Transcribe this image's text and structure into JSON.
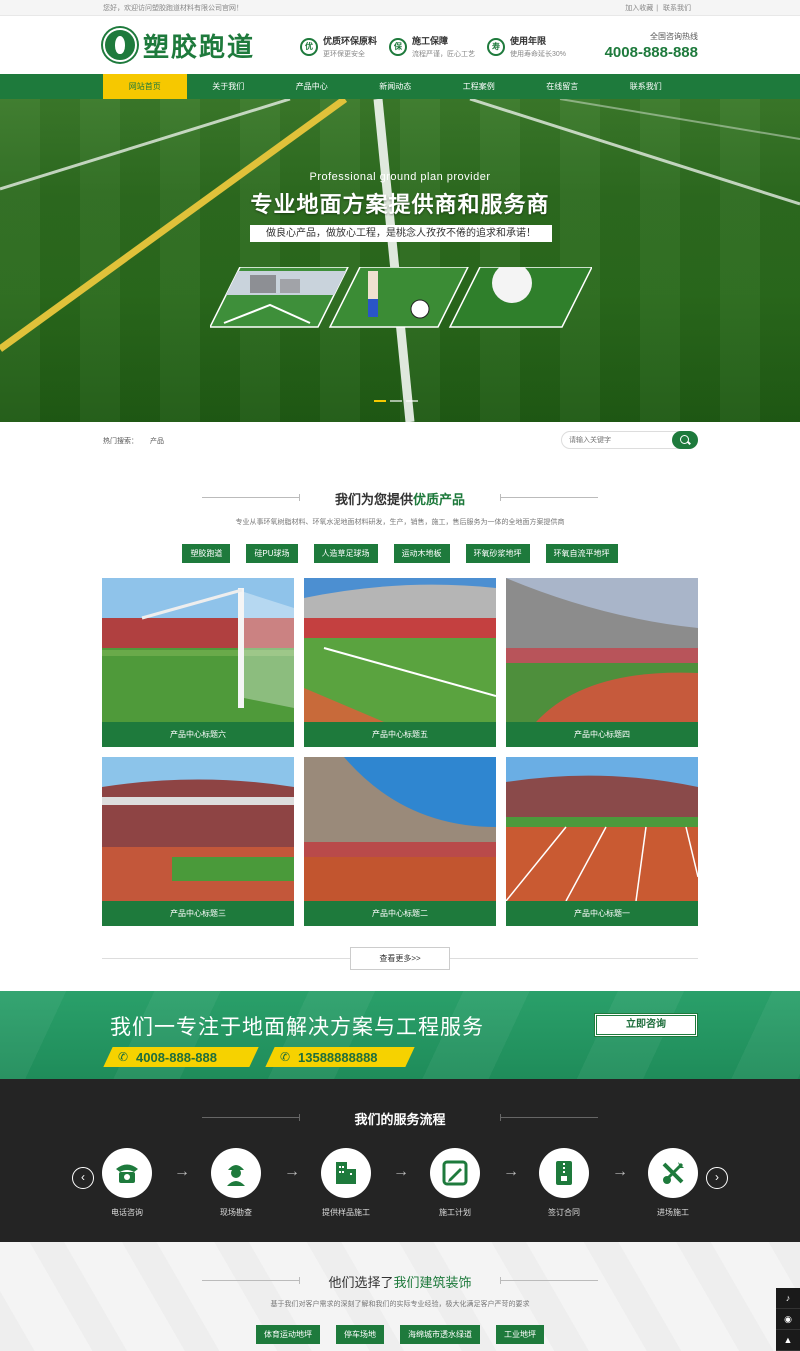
{
  "topbar": {
    "welcome": "您好，欢迎访问塑胶跑道材料有限公司官网！",
    "links": [
      "加入收藏",
      "联系我们"
    ]
  },
  "header": {
    "logo_text": "塑胶跑道",
    "features": [
      {
        "icon": "优",
        "title": "优质环保原料",
        "sub": "更环保更安全"
      },
      {
        "icon": "保",
        "title": "施工保障",
        "sub": "流程严谨，匠心工艺"
      },
      {
        "icon": "寿",
        "title": "使用年限",
        "sub": "使用寿命延长30%"
      }
    ],
    "hotline_label": "全国咨询热线",
    "hotline_number": "4008-888-888"
  },
  "nav": {
    "items": [
      "网站首页",
      "关于我们",
      "产品中心",
      "新闻动态",
      "工程案例",
      "在线留言",
      "联系我们"
    ],
    "active_index": 0
  },
  "banner": {
    "subtitle_en": "Professional ground plan provider",
    "headline": "专业地面方案提供商和服务商",
    "slogan": "做良心产品，做放心工程，是桃念人孜孜不倦的追求和承诺！",
    "slide_count": 3,
    "active_slide": 0
  },
  "search": {
    "hot_label": "热门搜索：",
    "hot_items": [
      "产品"
    ],
    "placeholder": "请输入关键字"
  },
  "products_section": {
    "title_prefix": "我们为您提供",
    "title_highlight": "优质产品",
    "description": "专业从事环氧树脂材料、环氧水泥地面材料研发，生产，销售，施工，售后服务为一体的全地面方案提供商",
    "tags": [
      "塑胶跑道",
      "硅PU球场",
      "人造草足球场",
      "运动木地板",
      "环氧砂浆地坪",
      "环氧自流平地坪"
    ],
    "items": [
      {
        "caption": "产品中心标题六",
        "scene": "goal"
      },
      {
        "caption": "产品中心标题五",
        "scene": "pitch"
      },
      {
        "caption": "产品中心标题四",
        "scene": "track-curve"
      },
      {
        "caption": "产品中心标题三",
        "scene": "stands"
      },
      {
        "caption": "产品中心标题二",
        "scene": "bowl"
      },
      {
        "caption": "产品中心标题一",
        "scene": "lanes"
      }
    ],
    "more_label": "查看更多>>"
  },
  "cta": {
    "title": "我们一专注于地面解决方案与工程服务",
    "phones": [
      "4008-888-888",
      "13588888888"
    ],
    "consult_label": "立即咨询"
  },
  "process": {
    "title": "我们的服务流程",
    "steps": [
      {
        "label": "电话咨询",
        "icon": "phone-icon"
      },
      {
        "label": "现场勘查",
        "icon": "worker-icon"
      },
      {
        "label": "提供样品施工",
        "icon": "building-icon"
      },
      {
        "label": "施工计划",
        "icon": "pencil-icon"
      },
      {
        "label": "签订合同",
        "icon": "contract-icon"
      },
      {
        "label": "进场施工",
        "icon": "tools-icon"
      }
    ],
    "prev": "‹",
    "next": "›"
  },
  "clients": {
    "title_prefix": "他们选择了",
    "title_highlight": "我们建筑装饰",
    "description": "基于我们对客户需求的深刻了解和我们的实际专业经验，极大化满足客户严苛的要求",
    "tags": [
      "体育运动地坪",
      "停车场地",
      "海绵城市透水绿道",
      "工业地坪"
    ]
  },
  "colors": {
    "brand_green": "#1e7a3c",
    "accent_yellow": "#f6c800",
    "dark_band": "#242424"
  }
}
